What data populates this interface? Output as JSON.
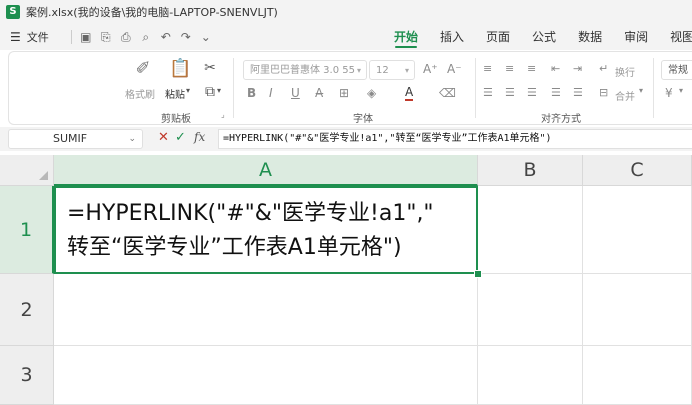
{
  "window": {
    "logo_letter": "S",
    "title": "案例.xlsx(我的设备\\我的电脑-LAPTOP-SNENVLJT)"
  },
  "menubar": {
    "file_label": "文件",
    "tabs": [
      {
        "label": "开始",
        "active": true
      },
      {
        "label": "插入",
        "active": false
      },
      {
        "label": "页面",
        "active": false
      },
      {
        "label": "公式",
        "active": false
      },
      {
        "label": "数据",
        "active": false
      },
      {
        "label": "审阅",
        "active": false
      },
      {
        "label": "视图",
        "active": false
      }
    ]
  },
  "ribbon": {
    "clipboard": {
      "format_painter": "格式刷",
      "paste": "粘贴",
      "group_label": "剪贴板"
    },
    "font": {
      "font_name": "阿里巴巴普惠体 3.0 55",
      "font_size": "12",
      "group_label": "字体"
    },
    "alignment": {
      "wrap": "换行",
      "merge": "合并",
      "group_label": "对齐方式"
    },
    "number": {
      "format": "常规"
    }
  },
  "formula_bar": {
    "name_box": "SUMIF",
    "cancel_symbol": "✕",
    "confirm_symbol": "✓",
    "fx_label": "fx",
    "formula": "=HYPERLINK(\"#\"&\"医学专业!a1\",\"转至“医学专业”工作表A1单元格\")"
  },
  "sheet": {
    "columns": [
      "A",
      "B",
      "C"
    ],
    "rows": [
      "1",
      "2",
      "3"
    ],
    "active_cell": "A1",
    "cell_a1_lines": [
      "=HYPERLINK(\"#\"&\"医学专业!a1\",\"",
      "转至“医学专业”工作表A1单元格\")"
    ]
  },
  "colors": {
    "accent": "#1e8f4f"
  }
}
